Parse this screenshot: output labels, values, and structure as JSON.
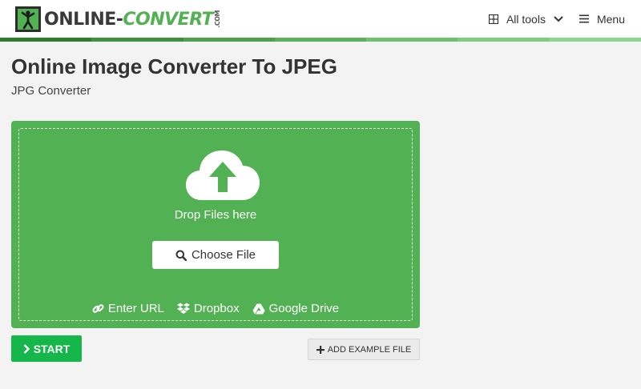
{
  "header": {
    "logo": {
      "text_main": "ONLINE-",
      "text_accent": "CONVERT",
      "text_com": ".COM"
    },
    "nav": {
      "all_tools_label": "All tools",
      "menu_label": "Menu"
    }
  },
  "colors": {
    "brand_green": "#52b152",
    "start_green": "#16b74a",
    "stripe": [
      "#2e7d32",
      "#3f9142",
      "#4da14f",
      "#5cb15e",
      "#6fc071",
      "#7ecc80",
      "#8dd68f"
    ]
  },
  "main": {
    "title": "Online Image Converter To JPEG",
    "subtitle": "JPG Converter"
  },
  "dropzone": {
    "drop_text": "Drop Files here",
    "choose_file_label": "Choose File",
    "sources": {
      "url_label": "Enter URL",
      "dropbox_label": "Dropbox",
      "gdrive_label": "Google Drive"
    }
  },
  "actions": {
    "start_label": "START",
    "example_label": "ADD EXAMPLE FILE"
  }
}
